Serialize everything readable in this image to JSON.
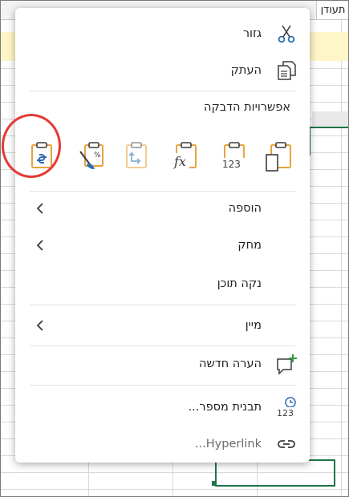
{
  "sheet": {
    "header_cell": "תעודן"
  },
  "menu": {
    "cut_label": "גזור",
    "copy_label": "העתק",
    "paste_options_heading": "אפשרויות הדבקה",
    "paste_options": [
      {
        "id": "paste-keep-source",
        "icon": "clipboard-page-icon"
      },
      {
        "id": "paste-values",
        "icon": "clipboard-123-icon"
      },
      {
        "id": "paste-formulas",
        "icon": "clipboard-fx-icon"
      },
      {
        "id": "paste-transpose",
        "icon": "clipboard-transpose-icon"
      },
      {
        "id": "paste-formatting",
        "icon": "clipboard-brush-icon"
      },
      {
        "id": "paste-link",
        "icon": "clipboard-link-icon",
        "highlighted": true
      }
    ],
    "insert_label": "הוספה",
    "delete_label": "מחק",
    "clear_contents_label": "נקה תוכן",
    "sort_label": "מיין",
    "new_comment_label": "הערה חדשה",
    "number_format_label": "תבנית מספר...",
    "hyperlink_label": "Hyperlink..."
  },
  "colors": {
    "accent_orange": "#e8a33d",
    "icon_dark": "#3b3b3b",
    "link_blue": "#2b6cb0",
    "comment_green": "#2e9e44",
    "highlight_red": "#e53935",
    "selection_green": "#217346"
  }
}
